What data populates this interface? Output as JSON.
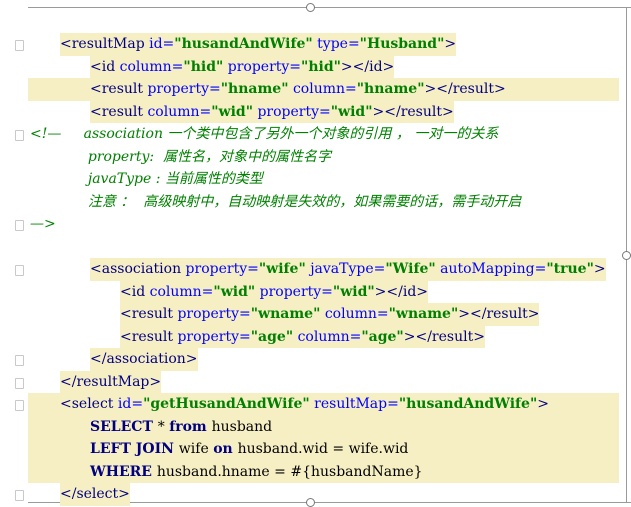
{
  "lines": [
    {
      "indent": 1,
      "fold": "open",
      "segs": [
        [
          "tag",
          "<resultMap "
        ],
        [
          "attr",
          "id="
        ],
        [
          "val",
          "\"husandAndWife\""
        ],
        [
          "plain",
          " "
        ],
        [
          "attr",
          "type="
        ],
        [
          "val",
          "\"Husband\""
        ],
        [
          "tag",
          ">"
        ]
      ]
    },
    {
      "indent": 2,
      "hl": true,
      "segs": [
        [
          "tag",
          "<id "
        ],
        [
          "attr",
          "column="
        ],
        [
          "val",
          "\"hid\""
        ],
        [
          "plain",
          " "
        ],
        [
          "attr",
          "property="
        ],
        [
          "val",
          "\"hid\""
        ],
        [
          "tag",
          "></id>"
        ]
      ]
    },
    {
      "indent": 2,
      "hl": true,
      "full": true,
      "segs": [
        [
          "tag",
          "<result "
        ],
        [
          "attr",
          "property="
        ],
        [
          "val",
          "\"hname\""
        ],
        [
          "plain",
          " "
        ],
        [
          "attr",
          "column="
        ],
        [
          "val",
          "\"hname\""
        ],
        [
          "tag",
          "></result>"
        ]
      ]
    },
    {
      "indent": 2,
      "hl": true,
      "segs": [
        [
          "tag",
          "<result "
        ],
        [
          "attr",
          "column="
        ],
        [
          "val",
          "\"wid\""
        ],
        [
          "plain",
          " "
        ],
        [
          "attr",
          "property="
        ],
        [
          "val",
          "\"wid\""
        ],
        [
          "tag",
          "></result>"
        ]
      ]
    },
    {
      "indent": 0,
      "fold": "open",
      "segs": [
        [
          "cm",
          "<!—     association 一个类中包含了另外一个对象的引用 ， 一对一的关系"
        ]
      ]
    },
    {
      "indent": 0,
      "segs": [
        [
          "cm",
          "             property:  属性名，对象中的属性名字"
        ]
      ]
    },
    {
      "indent": 0,
      "segs": [
        [
          "cm",
          "             javaType : 当前属性的类型"
        ]
      ]
    },
    {
      "indent": 0,
      "segs": [
        [
          "cm",
          "             注意 ：  高级映射中，自动映射是失效的，如果需要的话，需手动开启"
        ]
      ]
    },
    {
      "indent": 0,
      "fold": "close",
      "segs": [
        [
          "cm",
          "—>"
        ]
      ]
    },
    {
      "indent": 0,
      "segs": []
    },
    {
      "indent": 2,
      "fold": "open",
      "segs": [
        [
          "tag",
          "<association "
        ],
        [
          "attr",
          "property="
        ],
        [
          "val",
          "\"wife\""
        ],
        [
          "plain",
          " "
        ],
        [
          "attr",
          "javaType="
        ],
        [
          "val",
          "\"Wife\""
        ],
        [
          "plain",
          " "
        ],
        [
          "attr",
          "autoMapping="
        ],
        [
          "val",
          "\"true\""
        ],
        [
          "tag",
          ">"
        ]
      ]
    },
    {
      "indent": 3,
      "hl": true,
      "segs": [
        [
          "tag",
          "<id "
        ],
        [
          "attr",
          "column="
        ],
        [
          "val",
          "\"wid\""
        ],
        [
          "plain",
          " "
        ],
        [
          "attr",
          "property="
        ],
        [
          "val",
          "\"wid\""
        ],
        [
          "tag",
          "></id>"
        ]
      ]
    },
    {
      "indent": 3,
      "hl": true,
      "segs": [
        [
          "tag",
          "<result "
        ],
        [
          "attr",
          "property="
        ],
        [
          "val",
          "\"wname\""
        ],
        [
          "plain",
          " "
        ],
        [
          "attr",
          "column="
        ],
        [
          "val",
          "\"wname\""
        ],
        [
          "tag",
          "></result>"
        ]
      ]
    },
    {
      "indent": 3,
      "hl": true,
      "segs": [
        [
          "tag",
          "<result "
        ],
        [
          "attr",
          "property="
        ],
        [
          "val",
          "\"age\""
        ],
        [
          "plain",
          " "
        ],
        [
          "attr",
          "column="
        ],
        [
          "val",
          "\"age\""
        ],
        [
          "tag",
          "></result>"
        ]
      ]
    },
    {
      "indent": 2,
      "fold": "close",
      "segs": [
        [
          "tag",
          "</association>"
        ]
      ]
    },
    {
      "indent": 1,
      "fold": "close",
      "segs": [
        [
          "tag",
          "</resultMap>"
        ]
      ]
    },
    {
      "indent": 1,
      "fold": "open",
      "sql": true,
      "segs": [
        [
          "tag",
          "<select "
        ],
        [
          "attr",
          "id="
        ],
        [
          "val",
          "\"getHusandAndWife\""
        ],
        [
          "plain",
          " "
        ],
        [
          "attr",
          "resultMap="
        ],
        [
          "val",
          "\"husandAndWife\""
        ],
        [
          "tag",
          ">"
        ]
      ]
    },
    {
      "indent": 2,
      "sql": true,
      "segs": [
        [
          "kw",
          "SELECT "
        ],
        [
          "plain",
          "* "
        ],
        [
          "kw",
          "from "
        ],
        [
          "plain",
          "husband"
        ]
      ]
    },
    {
      "indent": 2,
      "sql": true,
      "segs": [
        [
          "kw",
          "LEFT JOIN "
        ],
        [
          "plain",
          "wife "
        ],
        [
          "kw",
          "on "
        ],
        [
          "plain",
          "husband.wid = wife.wid"
        ]
      ]
    },
    {
      "indent": 2,
      "sql": true,
      "segs": [
        [
          "kw",
          "WHERE "
        ],
        [
          "plain",
          "husband.hname = #{husbandName}"
        ]
      ]
    },
    {
      "indent": 1,
      "fold": "close",
      "segs": [
        [
          "tag",
          "</select>"
        ]
      ]
    }
  ]
}
